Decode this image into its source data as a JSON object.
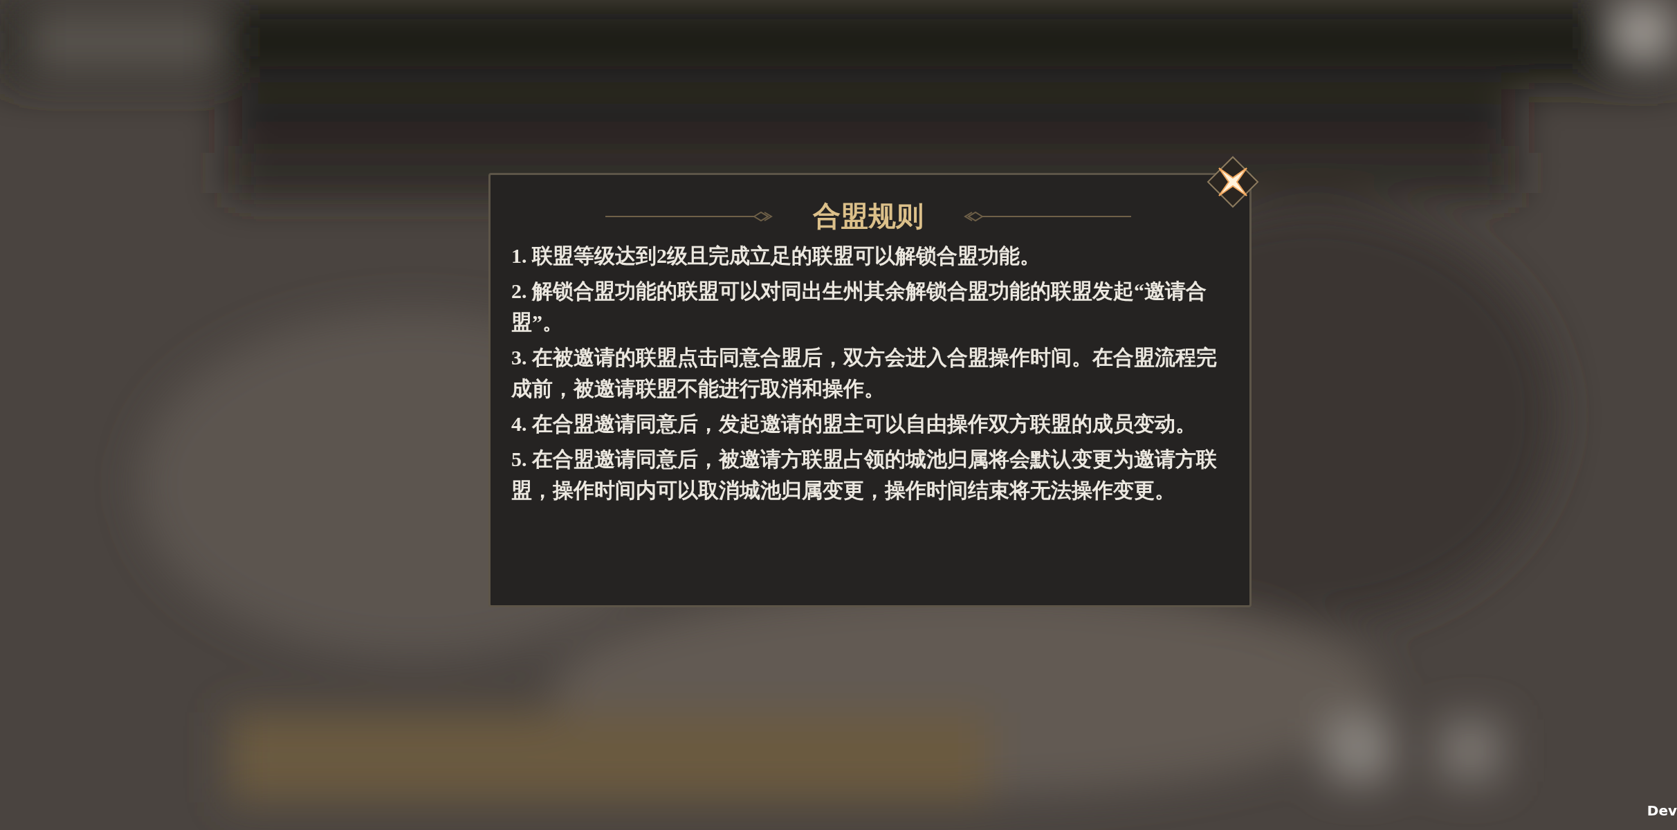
{
  "dialog": {
    "title": "合盟规则",
    "rules": [
      "1. 联盟等级达到2级且完成立足的联盟可以解锁合盟功能。",
      "2. 解锁合盟功能的联盟可以对同出生州其余解锁合盟功能的联盟发起“邀请合盟”。",
      "3. 在被邀请的联盟点击同意合盟后，双方会进入合盟操作时间。在合盟流程完成前，被邀请联盟不能进行取消和操作。",
      "4. 在合盟邀请同意后，发起邀请的盟主可以自由操作双方联盟的成员变动。",
      "5. 在合盟邀请同意后，被邀请方联盟占领的城池归属将会默认变更为邀请方联盟，操作时间内可以取消城池归属变更，操作时间结束将无法操作变更。"
    ]
  },
  "corner_label": "Dev"
}
